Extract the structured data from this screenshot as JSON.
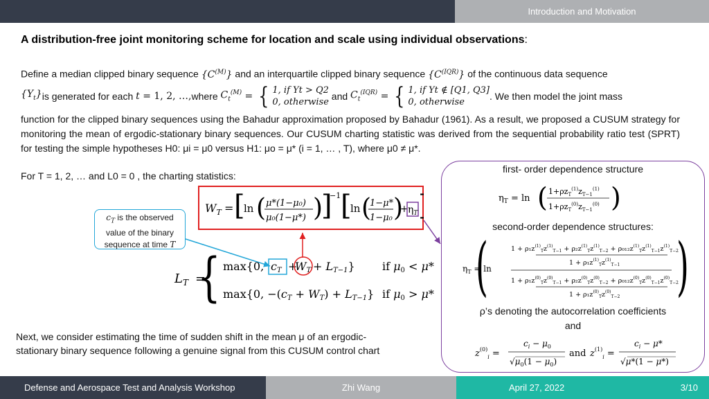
{
  "header": {
    "section": "Introduction and Motivation"
  },
  "title": {
    "text": "A distribution-free joint monitoring scheme for location and scale using individual observations",
    "suffix": ":"
  },
  "intro": {
    "p1_a": "Define a median clipped binary sequence ",
    "seq_m": "{C(M)}",
    "p1_b": " and  an interquartile clipped binary sequence ",
    "seq_iqr": "{C(IQR)}",
    "p1_c": " of the continuous data sequence",
    "p2_a": "{Yt}",
    "p2_b": " is generated for each ",
    "p2_t": "t = 1, 2, …,",
    "p2_c": " where ",
    "ctm": "Ct(M) =",
    "case_m_1": "1, if Yt > Q2",
    "case_m_2": "0, otherwise",
    "p2_and": " and ",
    "ctiqr": "Ct(IQR) =",
    "case_iqr_1": "1, if Yt ∉ [Q1, Q3]",
    "case_iqr_2": "0, otherwise",
    "p2_d": ". We then model the joint mass",
    "p3": "function for the clipped binary sequences using the Bahadur approximation proposed by Bahadur (1961).  As a result, we proposed a CUSUM strategy for monitoring the mean of ergodic-stationary binary sequences. Our CUSUM charting statistic was derived from the sequential probability ratio test (SPRT) for testing the simple hypotheses H0: μi = μ0 versus H1: μo = μ* (i = 1, … , T), where μ0 ≠ μ*."
  },
  "charting": {
    "label": "For T = 1, 2, … and L0 = 0 , the charting statistics:",
    "wt_formula": "WT = [ln( μ*(1−μ0) / μ0(1−μ*) )]^−1 [ln( (1−μ*)/(1−μ0) ) + ηT]",
    "lt_formula_row1": "max{0, cT + WT + LT−1}   if μ0 < μ*",
    "lt_formula_row2": "max{0, −(cT + WT) + LT−1}   if μ0 > μ*",
    "lt_label": "LT ="
  },
  "callout": {
    "line1": "cT is the observed",
    "line2": "value of the binary",
    "line3": "sequence at time T"
  },
  "panel": {
    "first_order_title": "first- order dependence structure",
    "second_order_title": "second-order dependence structures:",
    "rho_text": "ρ’s denoting the autocorrelation coefficients",
    "and_text": "and"
  },
  "conclusion": {
    "line1": "Next, we consider estimating the time of sudden shift in the mean μ of an ergodic-",
    "line2": "stationary binary sequence following a genuine signal from this CUSUM control chart"
  },
  "footer": {
    "event": "Defense and Aerospace Test and Analysis Workshop",
    "author": "Zhi Wang",
    "date": "April 27, 2022",
    "page": "3/10"
  },
  "colors": {
    "dark_bar": "#353c4a",
    "gray_bar": "#aeb0b3",
    "teal_bar": "#1fb8a4",
    "highlight_red": "#e02020",
    "callout_blue": "#22a6d8",
    "panel_purple": "#7b3f9e"
  }
}
